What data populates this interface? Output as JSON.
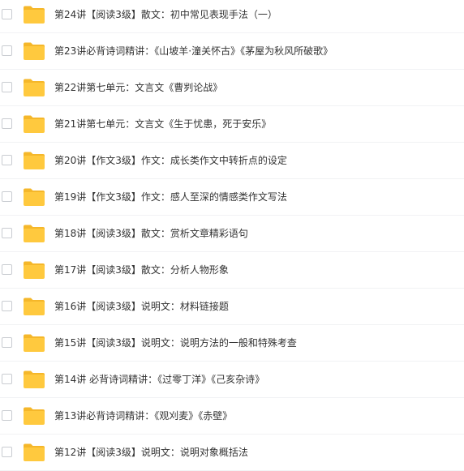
{
  "colors": {
    "folder": "#ffc93e",
    "folder_tab": "#f5b72a",
    "text": "#333333",
    "divider": "#f1f2f4",
    "checkbox_border": "#c9ccd1"
  },
  "files": [
    {
      "name": "第24讲【阅读3级】散文：初中常见表现手法（一）",
      "icon": "folder-icon",
      "checked": false
    },
    {
      "name": "第23讲必背诗词精讲：《山坡羊·潼关怀古》《茅屋为秋风所破歌》",
      "icon": "folder-icon",
      "checked": false
    },
    {
      "name": "第22讲第七单元：文言文《曹刿论战》",
      "icon": "folder-icon",
      "checked": false
    },
    {
      "name": "第21讲第七单元：文言文《生于忧患，死于安乐》",
      "icon": "folder-icon",
      "checked": false
    },
    {
      "name": "第20讲【作文3级】作文：成长类作文中转折点的设定",
      "icon": "folder-icon",
      "checked": false
    },
    {
      "name": "第19讲【作文3级】作文：感人至深的情感类作文写法",
      "icon": "folder-icon",
      "checked": false
    },
    {
      "name": "第18讲【阅读3级】散文：赏析文章精彩语句",
      "icon": "folder-icon",
      "checked": false
    },
    {
      "name": "第17讲【阅读3级】散文：分析人物形象",
      "icon": "folder-icon",
      "checked": false
    },
    {
      "name": "第16讲【阅读3级】说明文：材料链接题",
      "icon": "folder-icon",
      "checked": false
    },
    {
      "name": "第15讲【阅读3级】说明文：说明方法的一般和特殊考查",
      "icon": "folder-icon",
      "checked": false
    },
    {
      "name": "第14讲 必背诗词精讲：《过零丁洋》《己亥杂诗》",
      "icon": "folder-icon",
      "checked": false
    },
    {
      "name": "第13讲必背诗词精讲：《观刈麦》《赤壁》",
      "icon": "folder-icon",
      "checked": false
    },
    {
      "name": "第12讲【阅读3级】说明文：说明对象概括法",
      "icon": "folder-icon",
      "checked": false
    }
  ]
}
